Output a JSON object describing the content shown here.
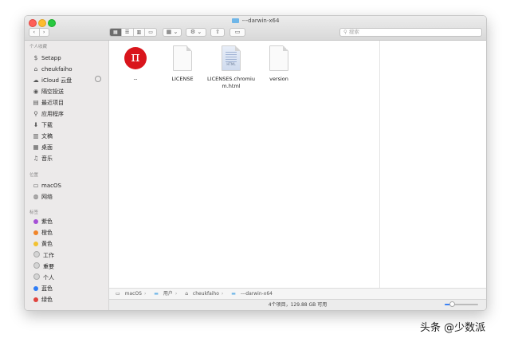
{
  "window": {
    "title": "---darwin-x64"
  },
  "toolbar": {
    "back": "‹",
    "forward": "›",
    "search_placeholder": "搜索"
  },
  "sidebar": {
    "favorites_header": "个人收藏",
    "favorites": [
      {
        "label": "Setapp",
        "icon": "$"
      },
      {
        "label": "cheukfaiho",
        "icon": "⌂"
      },
      {
        "label": "iCloud 云盘",
        "icon": "☁"
      },
      {
        "label": "隔空投送",
        "icon": "◉"
      },
      {
        "label": "最近项目",
        "icon": "▤"
      },
      {
        "label": "应用程序",
        "icon": "⚲"
      },
      {
        "label": "下载",
        "icon": "⬇"
      },
      {
        "label": "文稿",
        "icon": "▥"
      },
      {
        "label": "桌面",
        "icon": "▦"
      },
      {
        "label": "音乐",
        "icon": "♫"
      }
    ],
    "locations_header": "位置",
    "locations": [
      {
        "label": "macOS",
        "icon": "▭"
      },
      {
        "label": "网络",
        "icon": "◍"
      }
    ],
    "tags_header": "标签",
    "tags": [
      {
        "label": "紫色",
        "color": "#a550d6"
      },
      {
        "label": "橙色",
        "color": "#f0852a"
      },
      {
        "label": "黄色",
        "color": "#f2c231"
      },
      {
        "label": "工作",
        "color": "#d4d4d4"
      },
      {
        "label": "重要",
        "color": "#d4d4d4"
      },
      {
        "label": "个人",
        "color": "#d4d4d4"
      },
      {
        "label": "蓝色",
        "color": "#2f7df6"
      },
      {
        "label": "绿色",
        "color": "#e0443e"
      }
    ]
  },
  "files": [
    {
      "name": "--",
      "kind": "app"
    },
    {
      "name": "LICENSE",
      "kind": "doc"
    },
    {
      "name": "LICENSES.chromium.html",
      "kind": "html",
      "tag": "HTML"
    },
    {
      "name": "version",
      "kind": "doc"
    }
  ],
  "pathbar": {
    "items": [
      "macOS",
      "用户",
      "cheukfaiho",
      "---darwin-x64"
    ],
    "separator": "›"
  },
  "status": {
    "text": "4个项目，129.88 GB 可用"
  },
  "watermark": "头条 @少数派"
}
